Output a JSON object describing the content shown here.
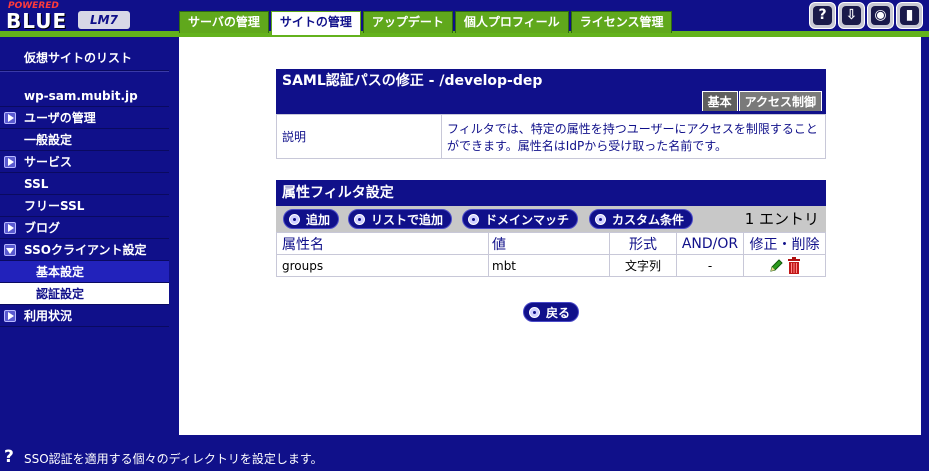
{
  "logo": {
    "powered": "POWERED",
    "name": "BLUE",
    "badge": "LM7"
  },
  "tabs": [
    {
      "label": "サーバの管理",
      "active": false
    },
    {
      "label": "サイトの管理",
      "active": true
    },
    {
      "label": "アップデート",
      "active": false
    },
    {
      "label": "個人プロフィール",
      "active": false
    },
    {
      "label": "ライセンス管理",
      "active": false
    }
  ],
  "top_icons": [
    {
      "name": "help-icon",
      "glyph": "?"
    },
    {
      "name": "download-icon",
      "glyph": "⇩"
    },
    {
      "name": "view-icon",
      "glyph": "◉"
    },
    {
      "name": "logout-icon",
      "glyph": "▮"
    }
  ],
  "sidebar": {
    "vsite_list": "仮想サイトのリスト",
    "site_name": "wp-sam.mubit.jp",
    "items": [
      {
        "label": "ユーザの管理",
        "arrow": "right"
      },
      {
        "label": "一般設定",
        "arrow": "none"
      },
      {
        "label": "サービス",
        "arrow": "right"
      },
      {
        "label": "SSL",
        "arrow": "none"
      },
      {
        "label": "フリーSSL",
        "arrow": "none"
      },
      {
        "label": "ブログ",
        "arrow": "right"
      },
      {
        "label": "SSOクライアント設定",
        "arrow": "down"
      },
      {
        "label": "基本設定",
        "arrow": "none",
        "sub": true,
        "state": "selected"
      },
      {
        "label": "認証設定",
        "arrow": "none",
        "sub": true,
        "state": "current"
      },
      {
        "label": "利用状況",
        "arrow": "right"
      }
    ]
  },
  "panel1": {
    "title": "SAML認証パスの修正 - /develop-dep",
    "subtabs": [
      "基本",
      "アクセス制御"
    ],
    "desc_label": "説明",
    "desc_text": "フィルタでは、特定の属性を持つユーザーにアクセスを制限することができます。属性名はIdPから受け取った名前です。"
  },
  "panel2": {
    "title": "属性フィルタ設定",
    "buttons": [
      "追加",
      "リストで追加",
      "ドメインマッチ",
      "カスタム条件"
    ],
    "entries": "1 エントリ",
    "headers": [
      "属性名",
      "値",
      "形式",
      "AND/OR",
      "修正・削除"
    ],
    "rows": [
      {
        "name": "groups",
        "value": "mbt",
        "format": "文字列",
        "andor": "-"
      }
    ]
  },
  "back_button": "戻る",
  "status_message": "SSO認証を適用する個々のディレクトリを設定します。",
  "colors": {
    "navy": "#10108a",
    "green": "#60a81c",
    "gray": "#c8c8c8"
  }
}
